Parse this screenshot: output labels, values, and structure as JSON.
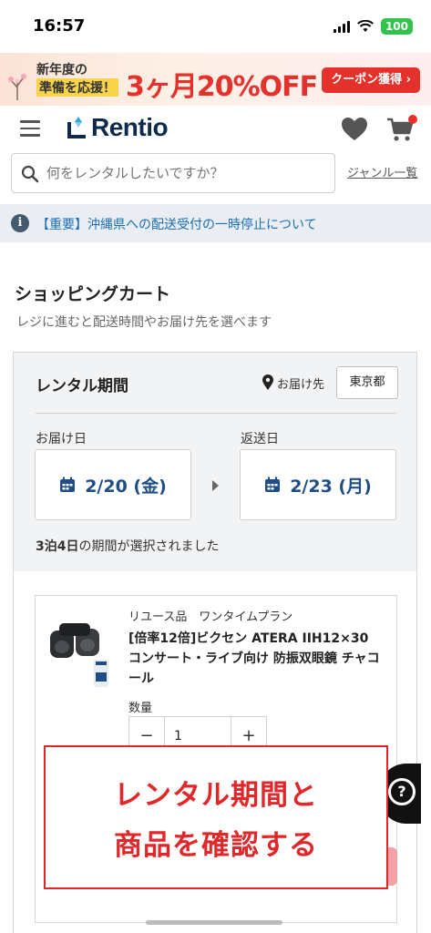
{
  "status_bar": {
    "time": "16:57",
    "battery": "100"
  },
  "promo": {
    "line1": "新年度の",
    "line2": "準備を応援！",
    "headline": "3ヶ月20%OFF",
    "button": "クーポン獲得 ›"
  },
  "header": {
    "logo": "Rentio"
  },
  "search": {
    "placeholder": "何をレンタルしたいですか？",
    "genre_link": "ジャンル一覧"
  },
  "notice": {
    "text": "【重要】沖縄県への配送受付の一時停止について",
    "icon": "i"
  },
  "cart": {
    "title": "ショッピングカート",
    "subtitle": "レジに進むと配送時間やお届け先を選べます"
  },
  "rental": {
    "label": "レンタル期間",
    "deliver_to_label": "お届け先",
    "prefecture": "東京都",
    "deliver_date_label": "お届け日",
    "return_date_label": "返送日",
    "deliver_date": "2/20 (金)",
    "return_date": "2/23 (月)",
    "period_bold": "3泊4日",
    "period_rest": "の期間が選択されました"
  },
  "item": {
    "tags": "リユース品　ワンタイムプラン",
    "name": "[倍率12倍]ビクセン ATERA IIH12×30 コンサート・ライブ向け 防振双眼鏡 チャコール",
    "qty_label": "数量",
    "qty_minus": "−",
    "qty_value": "1",
    "qty_plus": "+",
    "img_badge1": "最大",
    "img_badge2": "12倍"
  },
  "chat": {
    "symbol": "?"
  },
  "caption": {
    "line1": "レンタル期間と",
    "line2": "商品を確認する"
  },
  "colors": {
    "accent_red": "#e4312b",
    "date_blue": "#1f4e87",
    "link_blue": "#1a6fb5",
    "battery_green": "#33c24d"
  }
}
